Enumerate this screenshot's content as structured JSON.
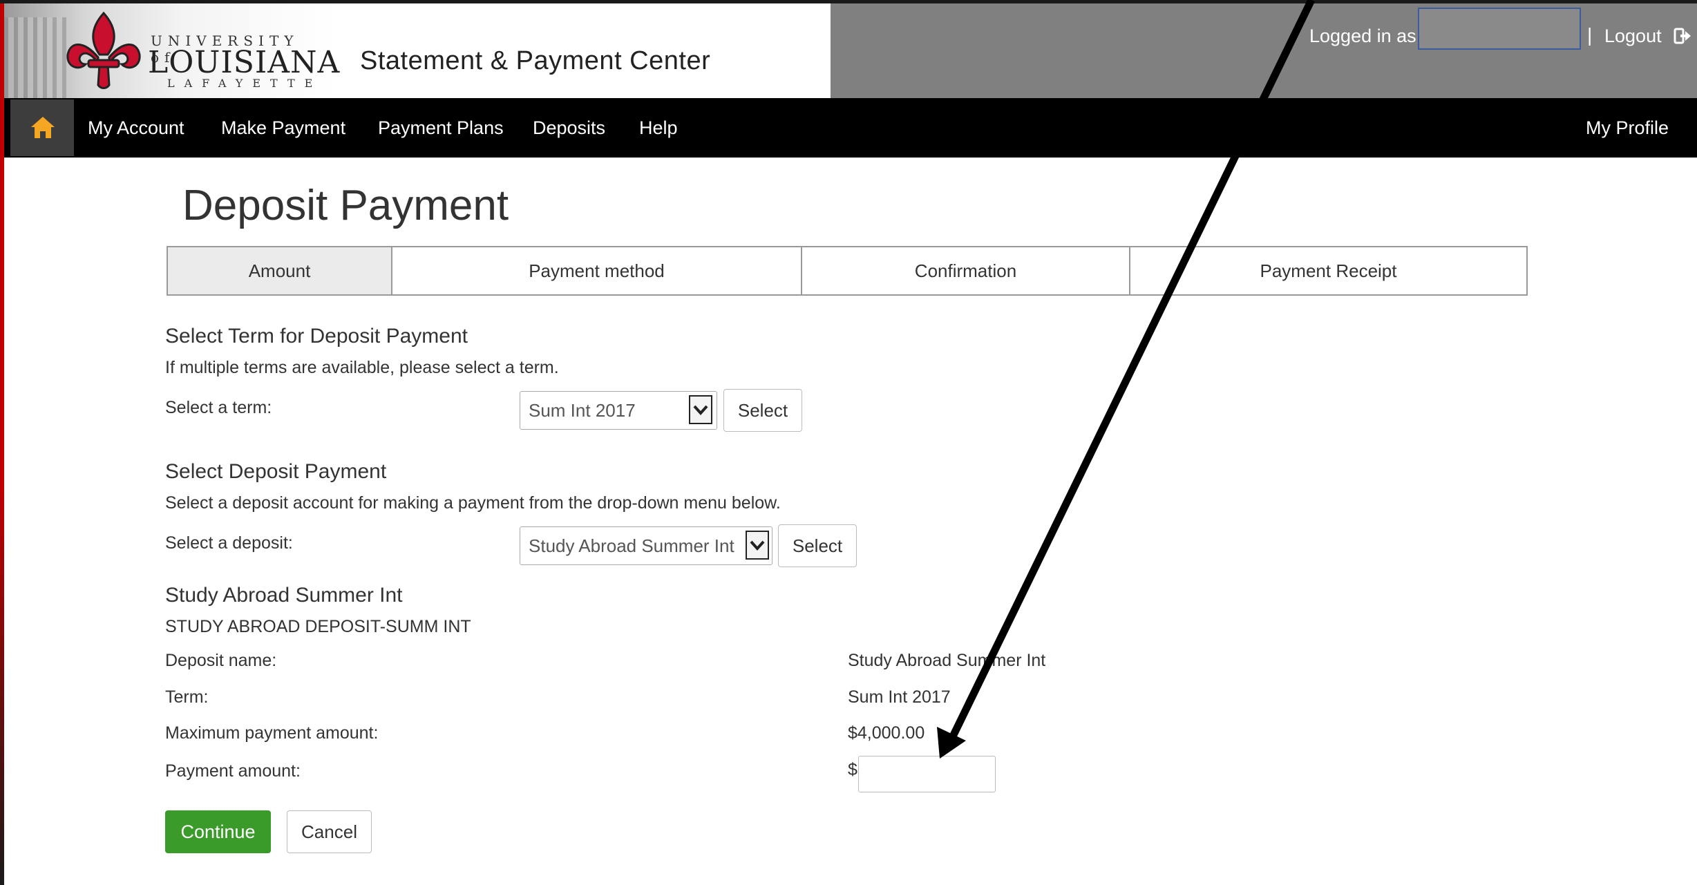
{
  "header": {
    "logo": {
      "line1": "UNIVERSITY of",
      "line2": "LOUISIANA",
      "line3": "LAFAYETTE"
    },
    "site_title": "Statement & Payment Center",
    "logged_in_label": "Logged in as",
    "username": "",
    "separator": "|",
    "logout_label": "Logout"
  },
  "nav": {
    "home_icon": "home-icon",
    "items": [
      "My Account",
      "Make Payment",
      "Payment Plans",
      "Deposits",
      "Help"
    ],
    "profile_label": "My Profile"
  },
  "page": {
    "title": "Deposit Payment",
    "steps": [
      {
        "label": "Amount",
        "active": true
      },
      {
        "label": "Payment method",
        "active": false
      },
      {
        "label": "Confirmation",
        "active": false
      },
      {
        "label": "Payment Receipt",
        "active": false
      }
    ]
  },
  "term_section": {
    "title": "Select Term for Deposit Payment",
    "help": "If multiple terms are available, please select a term.",
    "label": "Select a term:",
    "selected": "Sum Int 2017",
    "button": "Select"
  },
  "deposit_section": {
    "title": "Select Deposit Payment",
    "help": "Select a deposit account for making a payment from the drop-down menu below.",
    "label": "Select a deposit:",
    "selected": "Study Abroad Summer Int",
    "button": "Select"
  },
  "details": {
    "title": "Study Abroad Summer Int",
    "subtitle": "STUDY ABROAD DEPOSIT-SUMM INT",
    "rows": [
      {
        "label": "Deposit name:",
        "value": "Study Abroad Summer Int"
      },
      {
        "label": "Term:",
        "value": "Sum Int 2017"
      },
      {
        "label": "Maximum payment amount:",
        "value": "$4,000.00"
      }
    ],
    "payment_amount_label": "Payment amount:",
    "currency_symbol": "$",
    "payment_amount_value": ""
  },
  "actions": {
    "continue": "Continue",
    "cancel": "Cancel"
  },
  "colors": {
    "nav_bg": "#000000",
    "user_bar_bg": "#808080",
    "continue_green": "#3a9a2a",
    "brand_red": "#c8102e",
    "home_icon": "#f5a623"
  }
}
